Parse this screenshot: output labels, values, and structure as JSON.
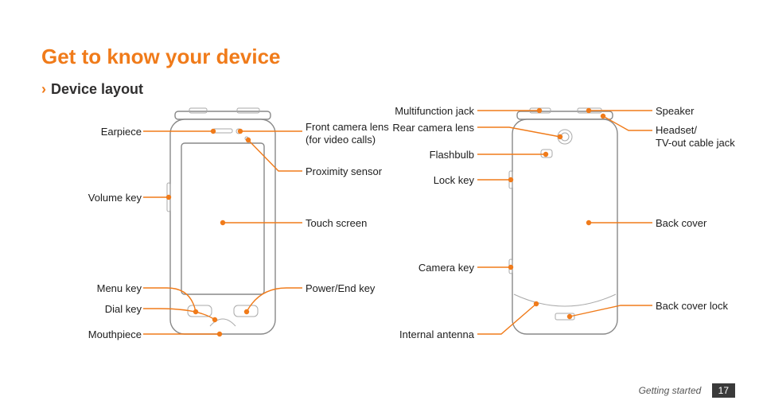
{
  "title": "Get to know your device",
  "subsection_chevron": "›",
  "subsection": "Device layout",
  "front": {
    "earpiece": "Earpiece",
    "volume": "Volume key",
    "menu": "Menu key",
    "dial": "Dial key",
    "mouthpiece": "Mouthpiece",
    "front_cam": "Front camera lens\n(for video calls)",
    "proximity": "Proximity sensor",
    "touch": "Touch screen",
    "power": "Power/End key"
  },
  "back": {
    "multijack": "Multifunction jack",
    "rearcam": "Rear camera lens",
    "flash": "Flashbulb",
    "lock": "Lock key",
    "camkey": "Camera key",
    "antenna": "Internal antenna",
    "speaker": "Speaker",
    "headset": "Headset/\nTV-out cable jack",
    "backcover": "Back cover",
    "coverlock": "Back cover lock"
  },
  "footer_section": "Getting started",
  "page_number": "17"
}
